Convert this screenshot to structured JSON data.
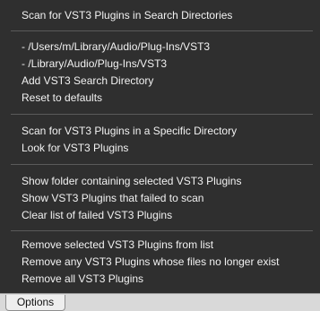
{
  "menu": {
    "group1": {
      "scan_search_dirs": "Scan for VST3 Plugins in Search Directories"
    },
    "group2": {
      "path_user": "- /Users/m/Library/Audio/Plug-Ins/VST3",
      "path_system": "- /Library/Audio/Plug-Ins/VST3",
      "add_search_dir": "Add VST3 Search Directory",
      "reset_defaults": "Reset to defaults"
    },
    "group3": {
      "scan_specific_dir": "Scan for VST3 Plugins in a Specific Directory",
      "look_for": "Look for VST3 Plugins"
    },
    "group4": {
      "show_folder": "Show folder containing selected VST3 Plugins",
      "show_failed": "Show VST3 Plugins that failed to scan",
      "clear_failed": "Clear list of failed VST3 Plugins"
    },
    "group5": {
      "remove_selected": "Remove selected VST3 Plugins from list",
      "remove_missing": "Remove any VST3 Plugins whose files no longer exist",
      "remove_all": "Remove all VST3 Plugins"
    }
  },
  "bottom_bar": {
    "options_tab": "Options"
  }
}
